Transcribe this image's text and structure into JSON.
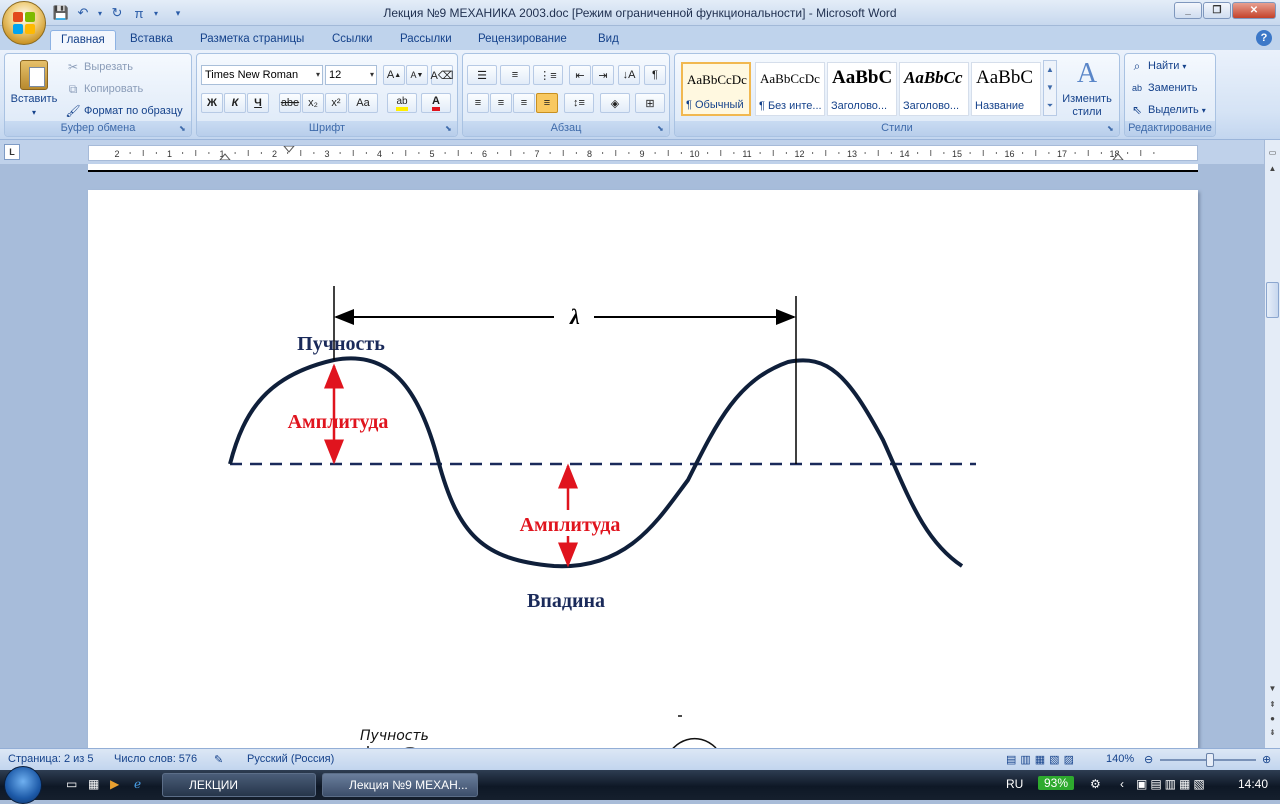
{
  "window": {
    "title": "Лекция №9 МЕХАНИКА 2003.doc [Режим ограниченной функциональности] - Microsoft Word"
  },
  "tabs": [
    "Главная",
    "Вставка",
    "Разметка страницы",
    "Ссылки",
    "Рассылки",
    "Рецензирование",
    "Вид"
  ],
  "clipboard": {
    "paste": "Вставить",
    "cut": "Вырезать",
    "copy": "Копировать",
    "format_painter": "Формат по образцу",
    "label": "Буфер обмена"
  },
  "font": {
    "name": "Times New Roman",
    "size": "12",
    "bold": "Ж",
    "italic": "К",
    "underline": "Ч",
    "strike": "abe",
    "sub": "x₂",
    "sup": "x²",
    "case": "Aa",
    "label": "Шрифт"
  },
  "paragraph": {
    "label": "Абзац"
  },
  "styles": {
    "items": [
      {
        "sample": "AaBbCcDc",
        "name": "¶ Обычный"
      },
      {
        "sample": "AaBbCcDc",
        "name": "¶ Без инте..."
      },
      {
        "sample": "AaBbC",
        "name": "Заголово..."
      },
      {
        "sample": "AaBbCc",
        "name": "Заголово..."
      },
      {
        "sample": "AaBbC",
        "name": "Название"
      }
    ],
    "change": "Изменить стили",
    "label": "Стили"
  },
  "editing": {
    "find": "Найти",
    "replace": "Заменить",
    "select": "Выделить",
    "label": "Редактирование"
  },
  "ruler": {
    "numbers": [
      "2",
      "1",
      "1",
      "2",
      "3",
      "4",
      "5",
      "6",
      "7",
      "8",
      "9",
      "10",
      "11",
      "12",
      "13",
      "14",
      "15",
      "16",
      "17",
      "18"
    ]
  },
  "diagram": {
    "lambda": "λ",
    "crest": "Пучность",
    "amplitude_top": "Амплитуда",
    "amplitude_bottom": "Амплитуда",
    "trough": "Впадина",
    "sketch_label": "Пучность"
  },
  "status": {
    "page": "Страница: 2 из 5",
    "words": "Число слов: 576",
    "language": "Русский (Россия)",
    "zoom": "140%"
  },
  "taskbar": {
    "items": [
      "ЛЕКЦИИ",
      "Лекция №9 МЕХАН..."
    ],
    "lang": "RU",
    "battery": "93%",
    "time": "14:40"
  },
  "colors": {
    "wave": "#0F1F3A",
    "amplitude": "#E0141E",
    "labels": "#1A2A5A"
  }
}
